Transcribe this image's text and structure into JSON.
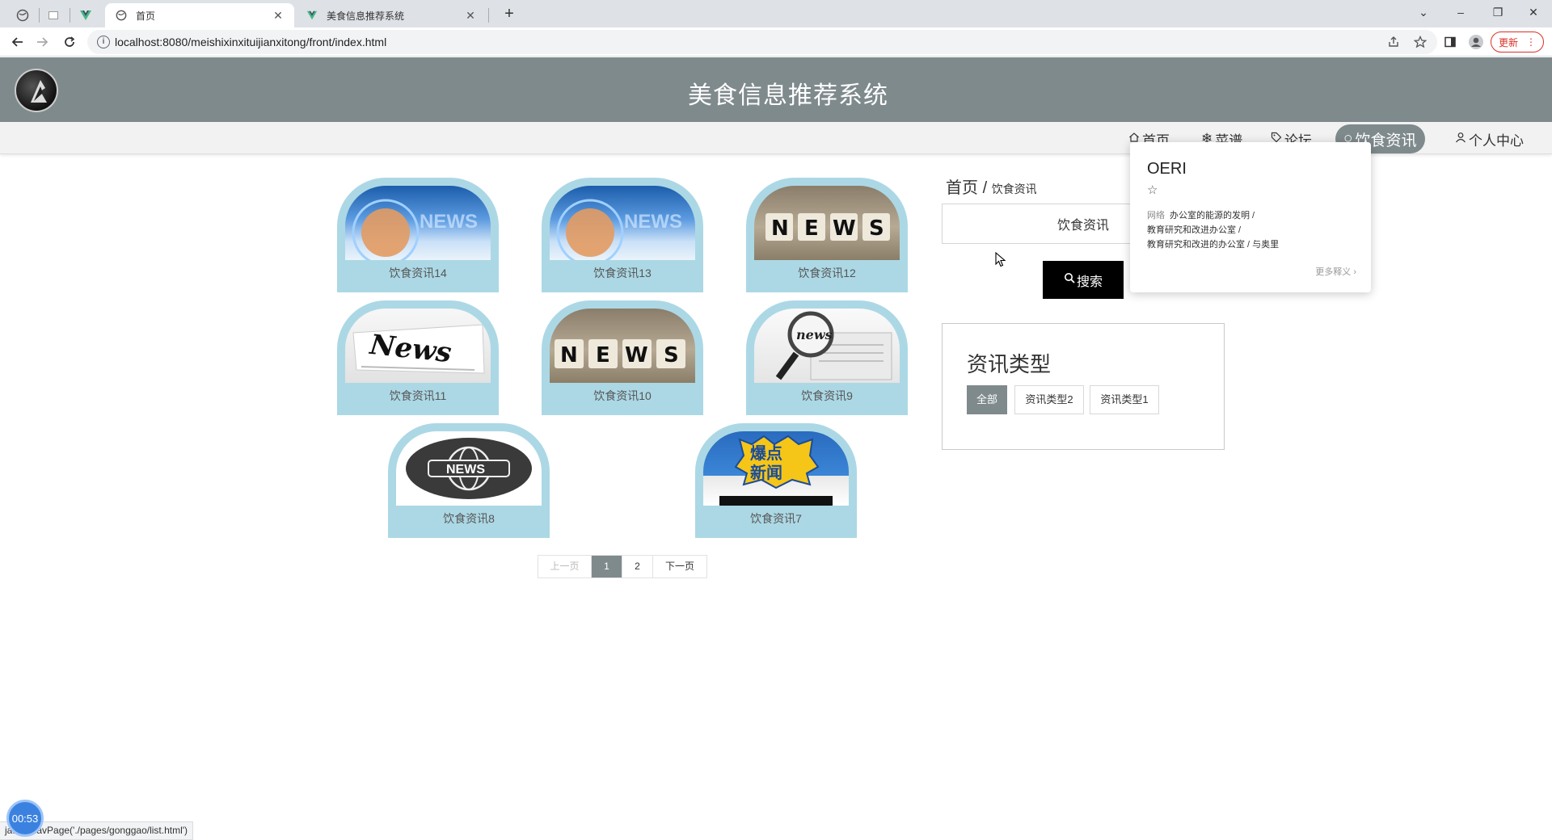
{
  "browser": {
    "tabs": [
      {
        "title": "首页",
        "active": true
      },
      {
        "title": "美食信息推荐系统",
        "active": false
      }
    ],
    "new_tab": "+",
    "url": "localhost:8080/meishixinxituijianxitong/front/index.html",
    "update_label": "更新",
    "window_controls": {
      "dropdown": "⌄",
      "minimize": "–",
      "restore": "❐",
      "close": "✕"
    }
  },
  "site": {
    "title": "美食信息推荐系统",
    "nav": [
      {
        "label": "首页",
        "icon": "home-icon"
      },
      {
        "label": "菜谱",
        "icon": "snowflake-icon"
      },
      {
        "label": "论坛",
        "icon": "tag-icon"
      },
      {
        "label": "饮食资讯",
        "icon": "circle-icon",
        "active": true
      },
      {
        "label": "个人中心",
        "icon": "user-icon"
      }
    ]
  },
  "news": [
    {
      "title": "饮食资讯14",
      "image": "news-blue"
    },
    {
      "title": "饮食资讯13",
      "image": "news-blue"
    },
    {
      "title": "饮食资讯12",
      "image": "news-blocks"
    },
    {
      "title": "饮食资讯11",
      "image": "news-paper"
    },
    {
      "title": "饮食资讯10",
      "image": "news-blocks"
    },
    {
      "title": "饮食资讯9",
      "image": "news-magnifier"
    },
    {
      "title": "饮食资讯8",
      "image": "news-globe"
    },
    {
      "title": "饮食资讯7",
      "image": "breaking-news"
    }
  ],
  "pagination": {
    "prev": "上一页",
    "pages": [
      "1",
      "2"
    ],
    "current": "1",
    "next": "下一页"
  },
  "sidebar": {
    "breadcrumb_home": "首页",
    "breadcrumb_sep": "/",
    "breadcrumb_current": "饮食资讯",
    "search_value": "饮食资讯",
    "search_button": "搜索",
    "type_title": "资讯类型",
    "types": [
      {
        "label": "全部",
        "active": true
      },
      {
        "label": "资讯类型2",
        "active": false
      },
      {
        "label": "资讯类型1",
        "active": false
      }
    ]
  },
  "translate_popup": {
    "word": "OERI",
    "star": "☆",
    "tag": "网络",
    "lines": [
      "办公室的能源的发明 /",
      "教育研究和改进办公室 /",
      "教育研究和改进的办公室 / 与奥里"
    ],
    "more": "更多释义 ›"
  },
  "status_text": "ja...pt:navPage('./pages/gonggao/list.html')",
  "timer": "00:53",
  "colors": {
    "header": "#7f8a8d",
    "card": "#acd8e5",
    "search_button": "#000000"
  }
}
